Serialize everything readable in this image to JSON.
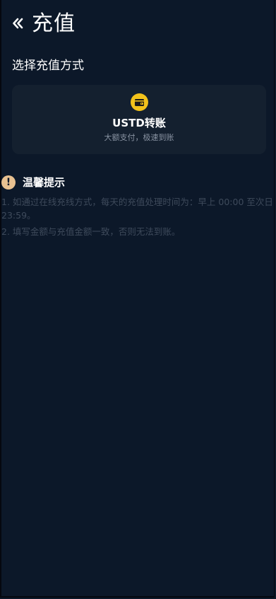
{
  "header": {
    "back_icon": "double-chevron-left-icon",
    "title": "充值"
  },
  "section": {
    "title": "选择充值方式"
  },
  "methods": [
    {
      "icon": "wallet-icon",
      "name": "USTD转账",
      "subtitle": "大额支付，极速到账"
    }
  ],
  "tips": {
    "icon": "exclamation-icon",
    "title": "温馨提示",
    "items": [
      "1. 如通过在线充线方式，每天的充值处理时间为：早上 00:00 至次日 23:59。",
      "2. 填写金额与充值金额一致，否则无法到账。"
    ]
  },
  "colors": {
    "background": "#0c1829",
    "card": "#14202f",
    "accent_yellow": "#f2c21b",
    "tip_icon": "#e8c191",
    "muted_text": "#3e4a5b"
  }
}
